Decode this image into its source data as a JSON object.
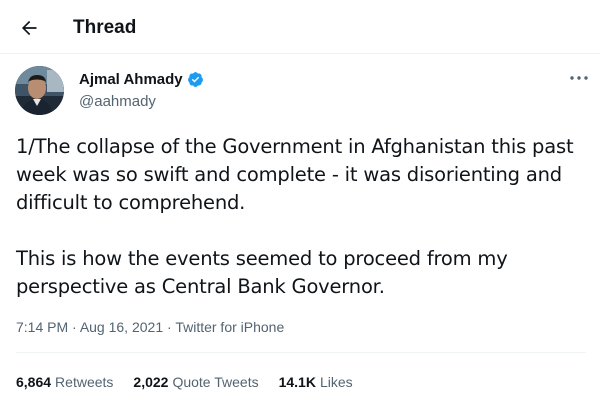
{
  "header": {
    "title": "Thread",
    "back_icon": "arrow-left-icon"
  },
  "tweet": {
    "author": {
      "name": "Ajmal Ahmady",
      "handle": "@aahmady",
      "verified": true,
      "verified_color": "#1d9bf0"
    },
    "more_icon": "more-horizontal-icon",
    "text_paragraphs": [
      "1/The collapse of the Government in Afghanistan this past week was so swift and complete - it was disorienting and difficult to comprehend.",
      "This is how the events seemed to proceed from my perspective as Central Bank Governor."
    ],
    "time": "7:14 PM",
    "separator": "·",
    "date": "Aug 16, 2021",
    "source": "Twitter for iPhone",
    "stats": {
      "retweets_count": "6,864",
      "retweets_label": "Retweets",
      "quote_tweets_count": "2,022",
      "quote_tweets_label": "Quote Tweets",
      "likes_count": "14.1K",
      "likes_label": "Likes"
    }
  },
  "colors": {
    "text_primary": "#0f1419",
    "text_secondary": "#536471",
    "divider": "#eff3f4"
  }
}
